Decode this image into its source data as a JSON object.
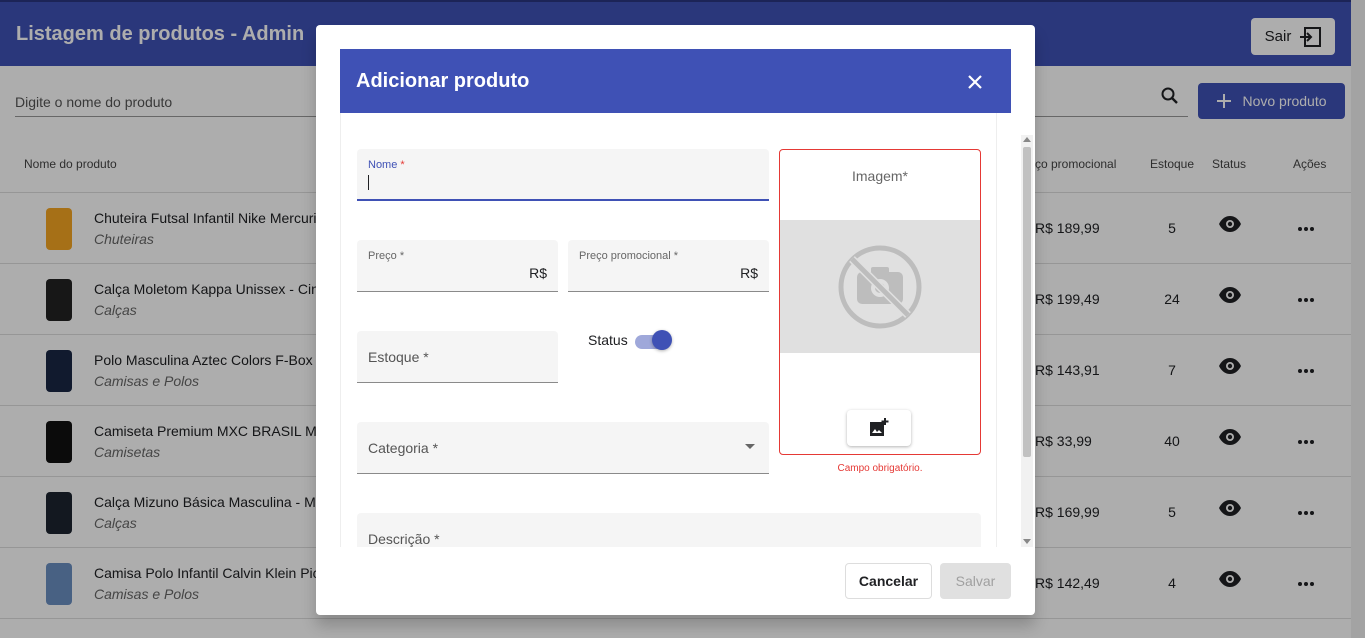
{
  "header": {
    "title": "Listagem de produtos - Admin",
    "logout_label": "Sair"
  },
  "search": {
    "placeholder": "Digite o nome do produto",
    "new_button": "Novo produto"
  },
  "table": {
    "columns": {
      "name": "Nome do produto",
      "promo": "ço promocional",
      "stock": "Estoque",
      "status": "Status",
      "actions": "Ações"
    },
    "rows": [
      {
        "name": "Chuteira Futsal Infantil Nike Mercuri",
        "category": "Chuteiras",
        "promo": "R$ 189,99",
        "stock": "5"
      },
      {
        "name": "Calça Moletom Kappa Unissex - Cin",
        "category": "Calças",
        "promo": "R$ 199,49",
        "stock": "24"
      },
      {
        "name": "Polo Masculina Aztec Colors F-Box",
        "category": "Camisas e Polos",
        "promo": "R$ 143,91",
        "stock": "7"
      },
      {
        "name": "Camiseta Premium MXC BRASIL Ma",
        "category": "Camisetas",
        "promo": "R$ 33,99",
        "stock": "40"
      },
      {
        "name": "Calça Mizuno Básica Masculina - M",
        "category": "Calças",
        "promo": "R$ 169,99",
        "stock": "5"
      },
      {
        "name": "Camisa Polo Infantil Calvin Klein Pic",
        "category": "Camisas e Polos",
        "promo": "R$ 142,49",
        "stock": "4"
      }
    ]
  },
  "dialog": {
    "title": "Adicionar produto",
    "fields": {
      "name_label": "Nome",
      "price_label": "Preço",
      "price_suffix": "R$",
      "promo_label": "Preço promocional",
      "promo_suffix": "R$",
      "stock_label": "Estoque",
      "category_label": "Categoria",
      "description_label": "Descrição",
      "required_mark": "*"
    },
    "status_label": "Status",
    "status_on": true,
    "image_title": "Imagem*",
    "image_error": "Campo obrigatório.",
    "cancel_label": "Cancelar",
    "save_label": "Salvar"
  },
  "colors": {
    "primary": "#3f51b5",
    "error": "#e53935"
  }
}
